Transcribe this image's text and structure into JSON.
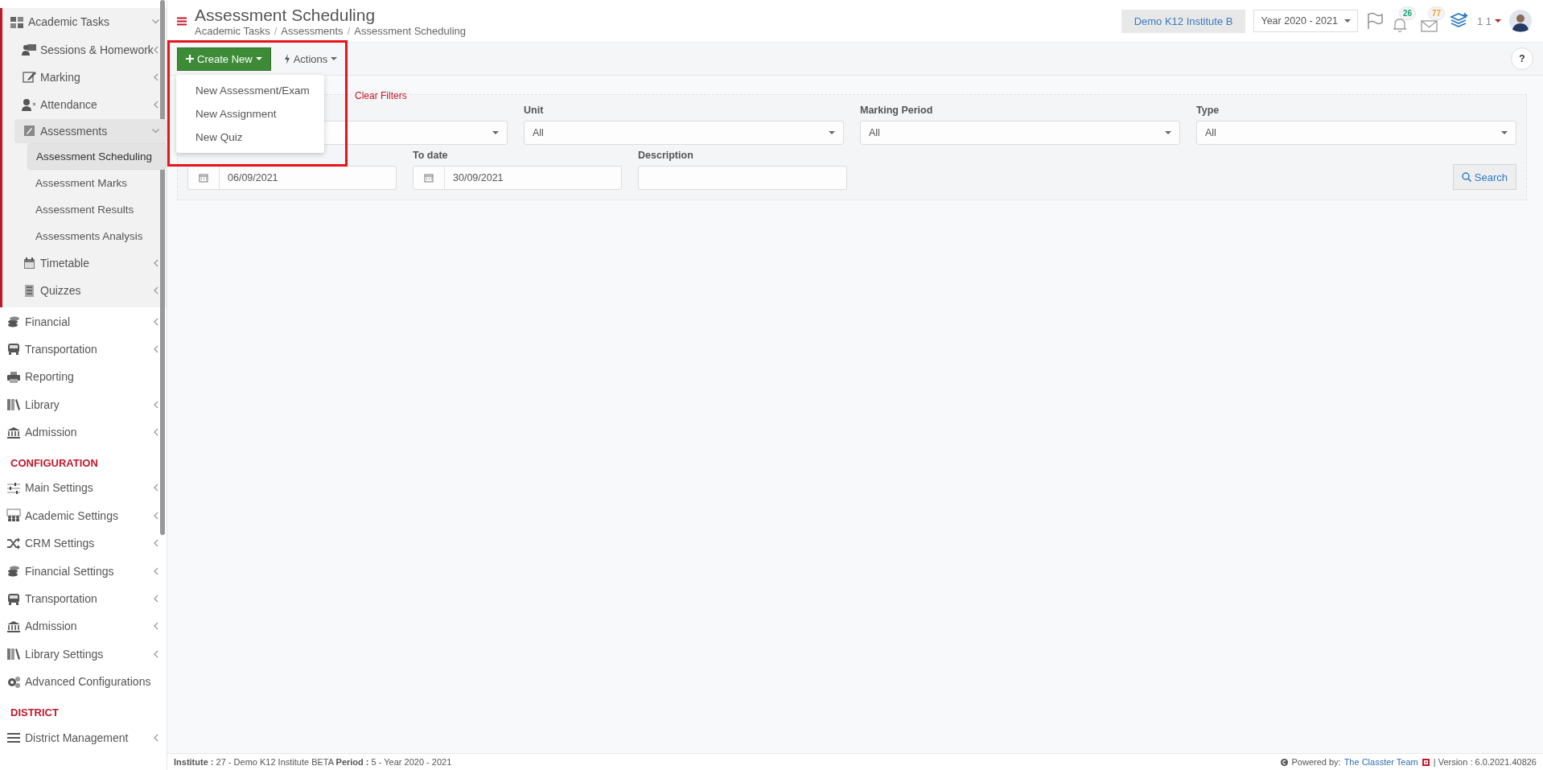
{
  "sidebar": {
    "groups": [
      {
        "items": [
          {
            "label": "Academic Tasks",
            "expanded": true,
            "children": [
              {
                "label": "Sessions & Homework",
                "expanded": false
              },
              {
                "label": "Marking",
                "expanded": false
              },
              {
                "label": "Attendance",
                "expanded": false
              },
              {
                "label": "Assessments",
                "expanded": true,
                "children": [
                  {
                    "label": "Assessment Scheduling",
                    "selected": true
                  },
                  {
                    "label": "Assessment Marks",
                    "selected": false
                  },
                  {
                    "label": "Assessment Results",
                    "selected": false
                  },
                  {
                    "label": "Assessments Analysis",
                    "selected": false
                  }
                ]
              },
              {
                "label": "Timetable",
                "expanded": false
              },
              {
                "label": "Quizzes",
                "expanded": false
              }
            ]
          },
          {
            "label": "Financial",
            "expanded": false
          },
          {
            "label": "Transportation",
            "expanded": false
          },
          {
            "label": "Reporting"
          },
          {
            "label": "Library",
            "expanded": false
          },
          {
            "label": "Admission",
            "expanded": false
          }
        ]
      },
      {
        "heading": "CONFIGURATION",
        "items": [
          {
            "label": "Main Settings",
            "expanded": false
          },
          {
            "label": "Academic Settings",
            "expanded": false
          },
          {
            "label": "CRM Settings",
            "expanded": false
          },
          {
            "label": "Financial Settings",
            "expanded": false
          },
          {
            "label": "Transportation",
            "expanded": false
          },
          {
            "label": "Admission",
            "expanded": false
          },
          {
            "label": "Library Settings",
            "expanded": false
          },
          {
            "label": "Advanced Configurations"
          }
        ]
      },
      {
        "heading": "DISTRICT",
        "items": [
          {
            "label": "District Management",
            "expanded": false
          }
        ]
      }
    ]
  },
  "header": {
    "title": "Assessment Scheduling",
    "breadcrumbs": [
      "Academic Tasks",
      "Assessments",
      "Assessment Scheduling"
    ],
    "breadcrumb_separator": "/",
    "institute": "Demo K12 Institute B",
    "year": "Year 2020 - 2021",
    "notifications": [
      {
        "kind": "bell",
        "count": "26",
        "color": "#1aa37a"
      },
      {
        "kind": "mail",
        "count": "77",
        "color": "#f0a030"
      }
    ],
    "user": "1 1"
  },
  "toolbar": {
    "create_button": "Create New",
    "actions_button": "Actions",
    "help": "?",
    "menu": {
      "open": true,
      "items": [
        "New Assessment/Exam",
        "New Assignment",
        "New Quiz"
      ]
    }
  },
  "filters": {
    "clear_link": "Clear Filters",
    "row_1": [
      {
        "kind": "select"
      },
      {
        "kind": "select",
        "label": "Unit",
        "value": "All"
      },
      {
        "kind": "select",
        "label": "Marking Period",
        "value": "All"
      },
      {
        "kind": "select",
        "label": "Type",
        "value": "All"
      }
    ],
    "row_2": [
      {
        "kind": "date",
        "value": "06/09/2021"
      },
      {
        "kind": "date",
        "label": "To date",
        "value": "30/09/2021"
      },
      {
        "kind": "text",
        "label": "Description"
      }
    ],
    "search_button": "Search"
  },
  "footer": {
    "info": "**Institute :** 27 - Demo K12 Institute BETA **Period :** 5 - Year 2020 - 2021",
    "powered_by": "Powered by:",
    "team_link": "The Classter Team",
    "version": "| Version : 6.0.2021.40826"
  }
}
